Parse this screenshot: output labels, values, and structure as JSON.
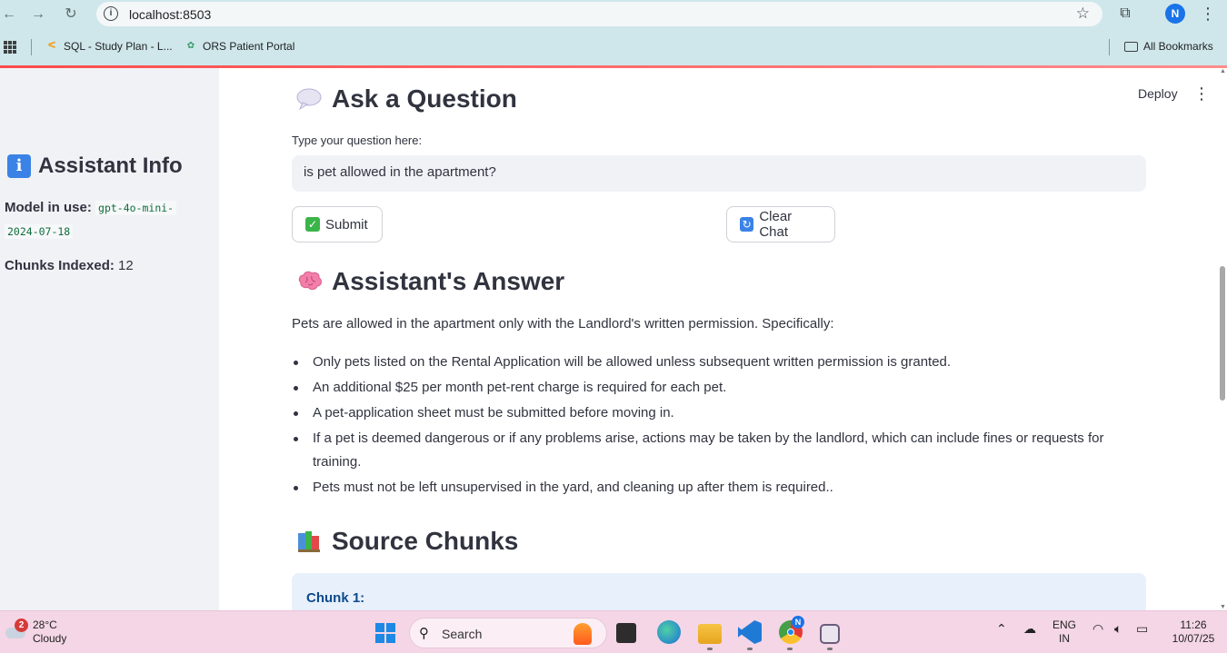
{
  "browser": {
    "url": "localhost:8503",
    "profile_initial": "N",
    "bookmarks": [
      {
        "label": "SQL - Study Plan - L..."
      },
      {
        "label": "ORS Patient Portal"
      }
    ],
    "all_bookmarks": "All Bookmarks"
  },
  "app": {
    "deploy_label": "Deploy",
    "sidebar": {
      "title": "Assistant Info",
      "model_label": "Model in use:",
      "model_value_line1": "gpt-4o-mini-",
      "model_value_line2": "2024-07-18",
      "chunks_label": "Chunks Indexed:",
      "chunks_value": "12"
    },
    "ask": {
      "title": "Ask a Question",
      "input_label": "Type your question here:",
      "input_value": "is pet allowed in the apartment?",
      "submit_label": "Submit",
      "clear_label": "Clear Chat"
    },
    "answer": {
      "title": "Assistant's Answer",
      "intro": "Pets are allowed in the apartment only with the Landlord's written permission. Specifically:",
      "bullets": [
        "Only pets listed on the Rental Application will be allowed unless subsequent written permission is granted.",
        "An additional $25 per month pet-rent charge is required for each pet.",
        "A pet-application sheet must be submitted before moving in.",
        "If a pet is deemed dangerous or if any problems arise, actions may be taken by the landlord, which can include fines or requests for training.",
        "Pets must not be left unsupervised in the yard, and cleaning up after them is required.."
      ]
    },
    "sources": {
      "title": "Source Chunks",
      "first_chunk_label": "Chunk 1:"
    }
  },
  "taskbar": {
    "weather_badge": "2",
    "temperature": "28°C",
    "condition": "Cloudy",
    "search_placeholder": "Search",
    "chrome_badge": "N",
    "lang_line1": "ENG",
    "lang_line2": "IN",
    "time": "11:26",
    "date": "10/07/25"
  }
}
